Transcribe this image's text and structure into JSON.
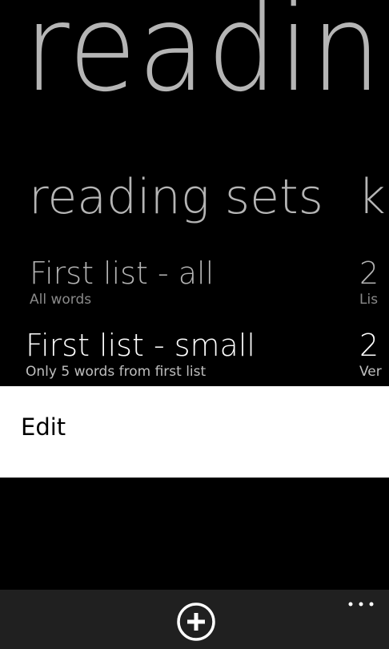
{
  "page_title": "readin",
  "pivot": {
    "active_header": "reading sets",
    "next_header_peek": "k"
  },
  "reading_sets": [
    {
      "title": "First list - all",
      "subtitle": "All words"
    },
    {
      "title": "First list - small",
      "subtitle": "Only 5 words from first list"
    }
  ],
  "next_pivot_peek_items": [
    {
      "title": "2",
      "subtitle": "Lis"
    },
    {
      "title": "2",
      "subtitle": "Ver"
    }
  ],
  "context_menu": {
    "items": [
      {
        "label": "Edit"
      }
    ]
  },
  "app_bar": {
    "add_icon": "add-circle-icon",
    "more_icon": "ellipsis-icon",
    "more_label": "..."
  },
  "colors": {
    "background": "#000000",
    "app_bar": "#202020",
    "context_menu": "#ffffff",
    "muted_text": "#b3b3b3",
    "subtitle_text": "#8a8a8a"
  }
}
